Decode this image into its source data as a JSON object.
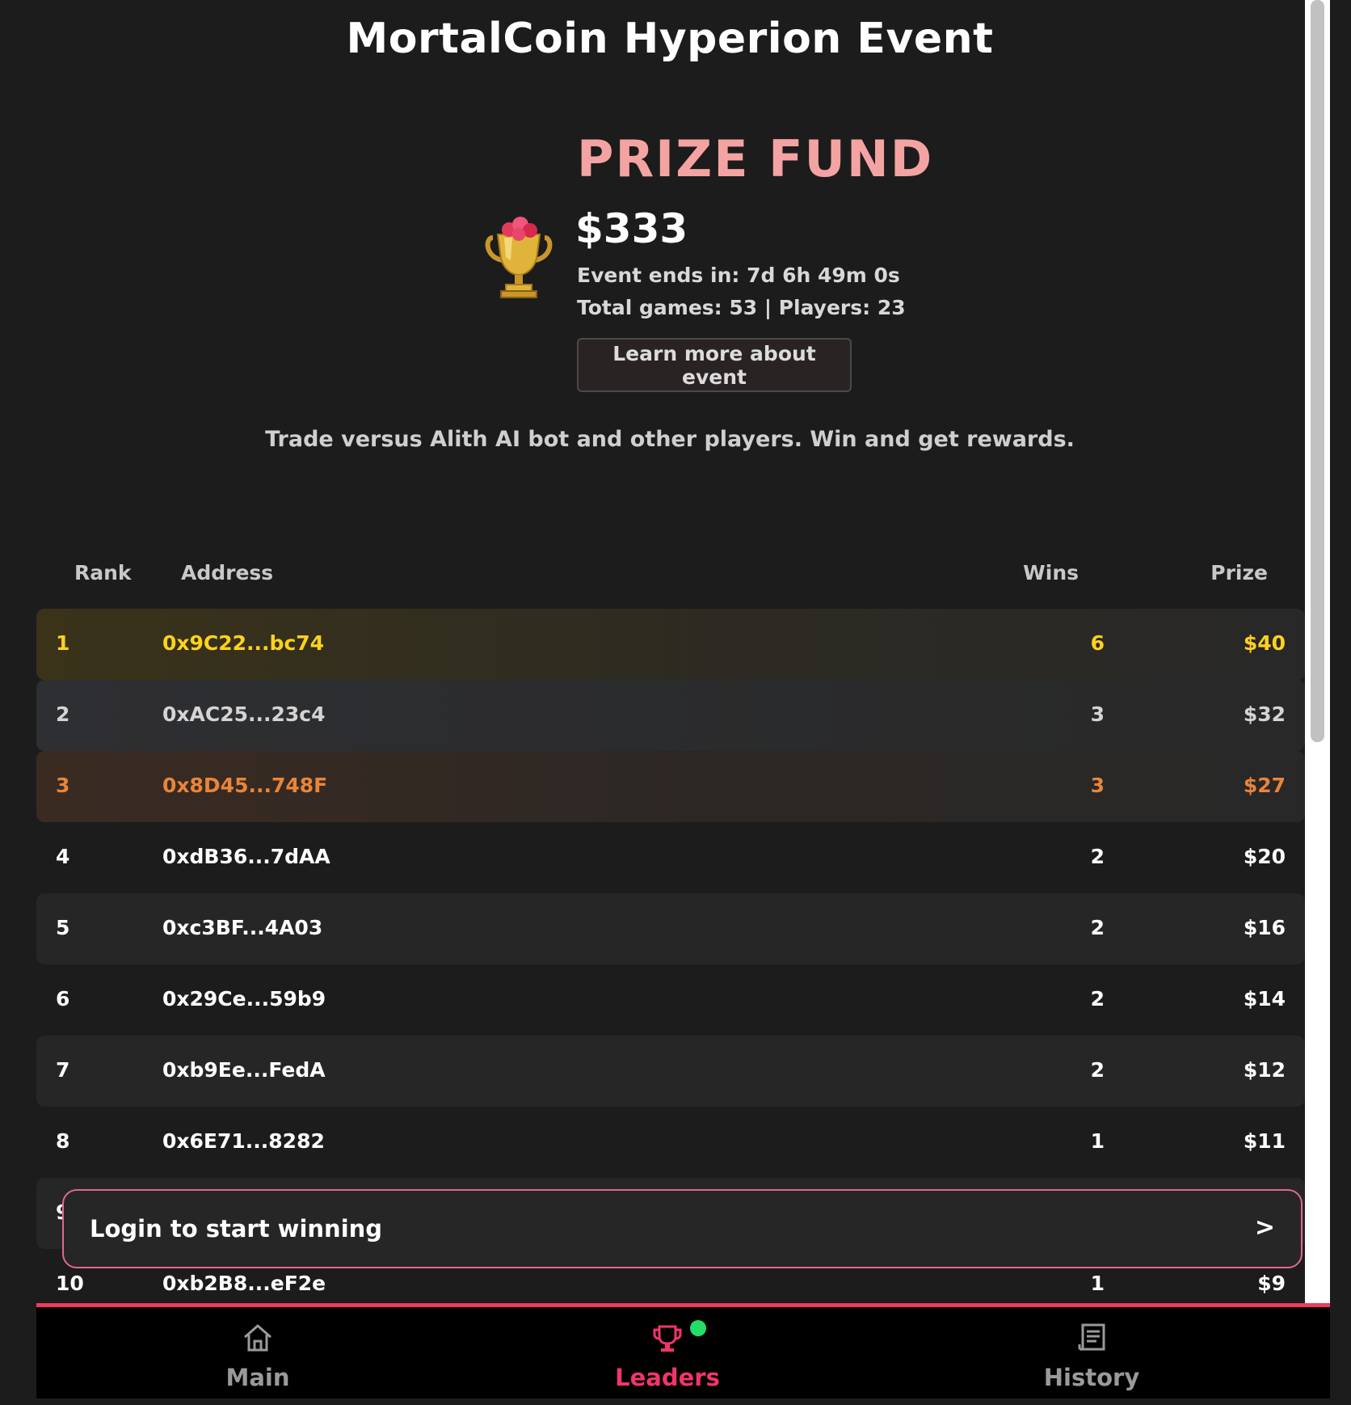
{
  "header": {
    "title": "MortalCoin Hyperion Event"
  },
  "prize": {
    "heading": "PRIZE FUND",
    "amount": "$333",
    "event_ends": "Event ends in: 7d 6h 49m 0s",
    "stats": "Total games: 53 | Players: 23",
    "learn_more_label": "Learn more about event",
    "trophy_icon": "trophy-icon"
  },
  "tagline": "Trade versus Alith AI bot and other players. Win and get rewards.",
  "leaderboard": {
    "columns": {
      "rank": "Rank",
      "address": "Address",
      "wins": "Wins",
      "prize": "Prize"
    },
    "rows": [
      {
        "rank": "1",
        "address": "0x9C22...bc74",
        "wins": "6",
        "prize": "$40"
      },
      {
        "rank": "2",
        "address": "0xAC25...23c4",
        "wins": "3",
        "prize": "$32"
      },
      {
        "rank": "3",
        "address": "0x8D45...748F",
        "wins": "3",
        "prize": "$27"
      },
      {
        "rank": "4",
        "address": "0xdB36...7dAA",
        "wins": "2",
        "prize": "$20"
      },
      {
        "rank": "5",
        "address": "0xc3BF...4A03",
        "wins": "2",
        "prize": "$16"
      },
      {
        "rank": "6",
        "address": "0x29Ce...59b9",
        "wins": "2",
        "prize": "$14"
      },
      {
        "rank": "7",
        "address": "0xb9Ee...FedA",
        "wins": "2",
        "prize": "$12"
      },
      {
        "rank": "8",
        "address": "0x6E71...8282",
        "wins": "1",
        "prize": "$11"
      },
      {
        "rank": "9",
        "address": "",
        "wins": "",
        "prize": ""
      },
      {
        "rank": "10",
        "address": "0xb2B8...eF2e",
        "wins": "1",
        "prize": "$9"
      }
    ]
  },
  "login_banner": {
    "label": "Login to start winning",
    "arrow": ">"
  },
  "bottom_nav": {
    "items": [
      {
        "label": "Main",
        "icon": "home-icon"
      },
      {
        "label": "Leaders",
        "icon": "trophy-icon",
        "active": true
      },
      {
        "label": "History",
        "icon": "document-icon"
      }
    ]
  },
  "colors": {
    "background": "#1c1c1c",
    "accent": "#ee3b5e",
    "prize_heading": "#f4a3a3",
    "gold": "#ffd21c",
    "silver": "#d4d4d4",
    "bronze": "#e8853a",
    "live_dot": "#22dd66"
  }
}
